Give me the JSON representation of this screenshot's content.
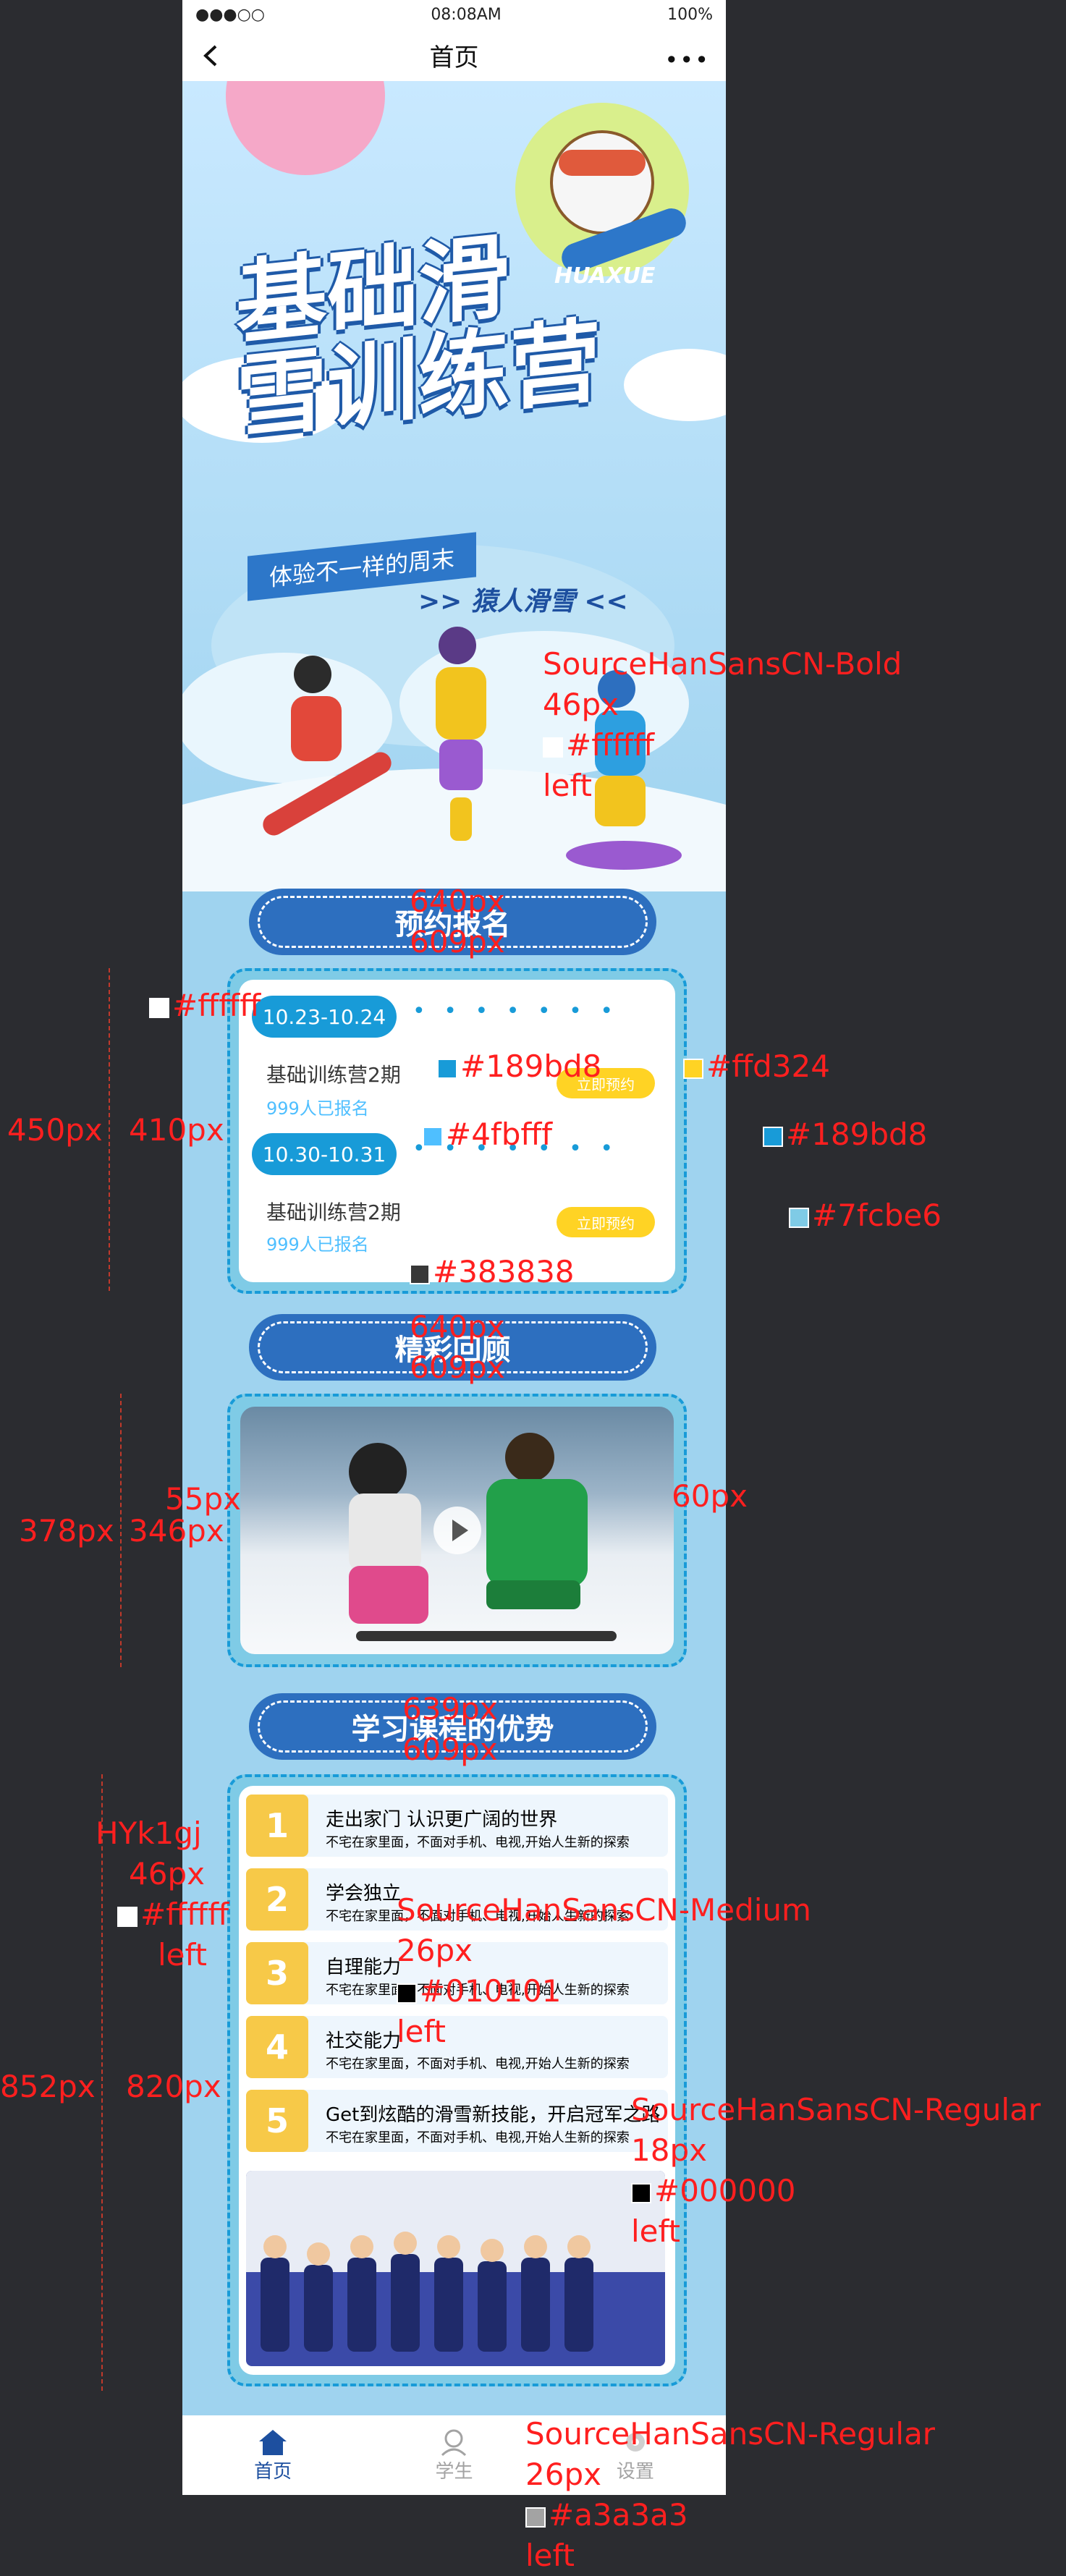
{
  "status_bar": {
    "carrier": "●●●○○",
    "time": "08:08AM",
    "battery": "100%"
  },
  "nav": {
    "title": "首页",
    "more": "•••"
  },
  "hero": {
    "title_line1": "基础滑",
    "title_line2": "雪训练营",
    "brand": "HUAXUE",
    "slogan": "体验不一样的周末",
    "subslogan": ">> 猿人滑雪 <<"
  },
  "sections": {
    "signup": {
      "title": "预约报名"
    },
    "review": {
      "title": "精彩回顾"
    },
    "advantages": {
      "title": "学习课程的优势"
    }
  },
  "sessions": [
    {
      "date": "10.23-10.24",
      "name": "基础训练营2期",
      "count": "999人已报名",
      "button": "立即预约"
    },
    {
      "date": "10.30-10.31",
      "name": "基础训练营2期",
      "count": "999人已报名",
      "button": "立即预约"
    }
  ],
  "advantages": [
    {
      "num": "1",
      "title": "走出家门 认识更广阔的世界",
      "desc": "不宅在家里面，不面对手机、电视,开始人生新的探索"
    },
    {
      "num": "2",
      "title": "学会独立",
      "desc": "不宅在家里面，不面对手机、电视,开始人生新的探索"
    },
    {
      "num": "3",
      "title": "自理能力",
      "desc": "不宅在家里面，不面对手机、电视,开始人生新的探索"
    },
    {
      "num": "4",
      "title": "社交能力",
      "desc": "不宅在家里面，不面对手机、电视,开始人生新的探索"
    },
    {
      "num": "5",
      "title": "Get到炫酷的滑雪新技能，开启冠军之路",
      "desc": "不宅在家里面，不面对手机、电视,开始人生新的探索"
    }
  ],
  "tabbar": [
    {
      "label": "首页",
      "icon": "home-icon"
    },
    {
      "label": "学生",
      "icon": "student-icon"
    },
    {
      "label": "设置",
      "icon": "settings-icon"
    }
  ],
  "annotations": {
    "a1_font": "SourceHanSansCN-Bold",
    "a1_size": "46px",
    "a1_color": "#ffffff",
    "a1_align": "left",
    "a2_w1": "640px",
    "a2_w2": "609px",
    "a3_color_white": "#ffffff",
    "a3_color_blue": "#189bd8",
    "a3_color_yellow": "#ffd324",
    "a3_color_lightblue": "#4fbfff",
    "a3_color_blue2": "#189bd8",
    "a3_color_panel": "#7fcbe6",
    "a3_color_text": "#383838",
    "a3_h1": "450px",
    "a3_h2": "410px",
    "a4_w1": "640px",
    "a4_w2": "609px",
    "a4_h1": "378px",
    "a4_h2": "346px",
    "a4_pad1": "55px",
    "a4_pad2": "60px",
    "a5_w1": "639px",
    "a5_w2": "609px",
    "a6_font": "HYk1gj",
    "a6_size": "46px",
    "a6_color": "#ffffff",
    "a6_align": "left",
    "a7_font": "SourceHanSansCN-Medium",
    "a7_size": "26px",
    "a7_color": "#010101",
    "a7_align": "left",
    "a8_font": "SourceHanSansCN-Regular",
    "a8_size": "18px",
    "a8_color": "#000000",
    "a8_align": "left",
    "a9_h1": "852px",
    "a9_h2": "820px",
    "a10_font": "SourceHanSansCN-Regular",
    "a10_size": "26px",
    "a10_color": "#a3a3a3",
    "a10_align": "left"
  },
  "colors": {
    "primary": "#189bd8",
    "accent": "#ffd324",
    "background": "#9fd3ef"
  }
}
